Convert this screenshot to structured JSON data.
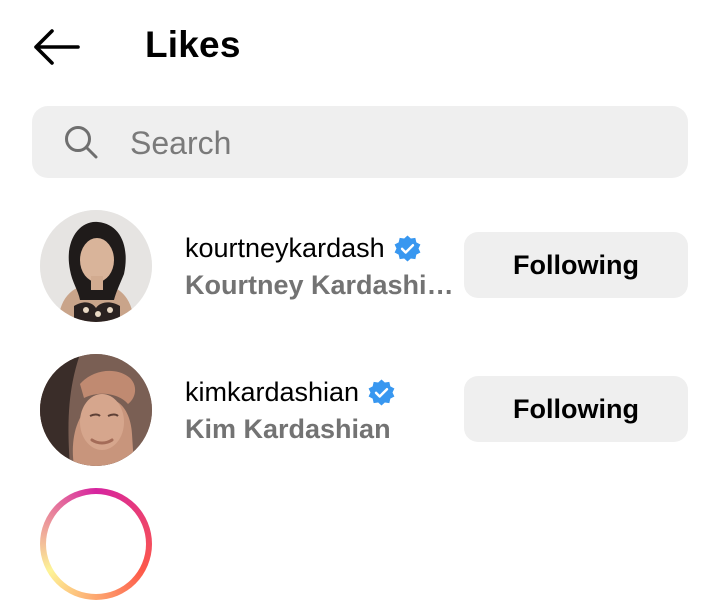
{
  "header": {
    "title": "Likes"
  },
  "search": {
    "placeholder": "Search"
  },
  "users": [
    {
      "username": "kourtneykardash",
      "full_name": "Kourtney Kardashia…",
      "verified": true,
      "button_label": "Following"
    },
    {
      "username": "kimkardashian",
      "full_name": "Kim Kardashian",
      "verified": true,
      "button_label": "Following"
    }
  ],
  "colors": {
    "verified_badge": "#3897f0",
    "secondary_text": "#737373",
    "button_bg": "#efefef"
  },
  "icons": {
    "back": "back-arrow-icon",
    "search": "search-icon",
    "verified": "verified-badge-icon"
  }
}
